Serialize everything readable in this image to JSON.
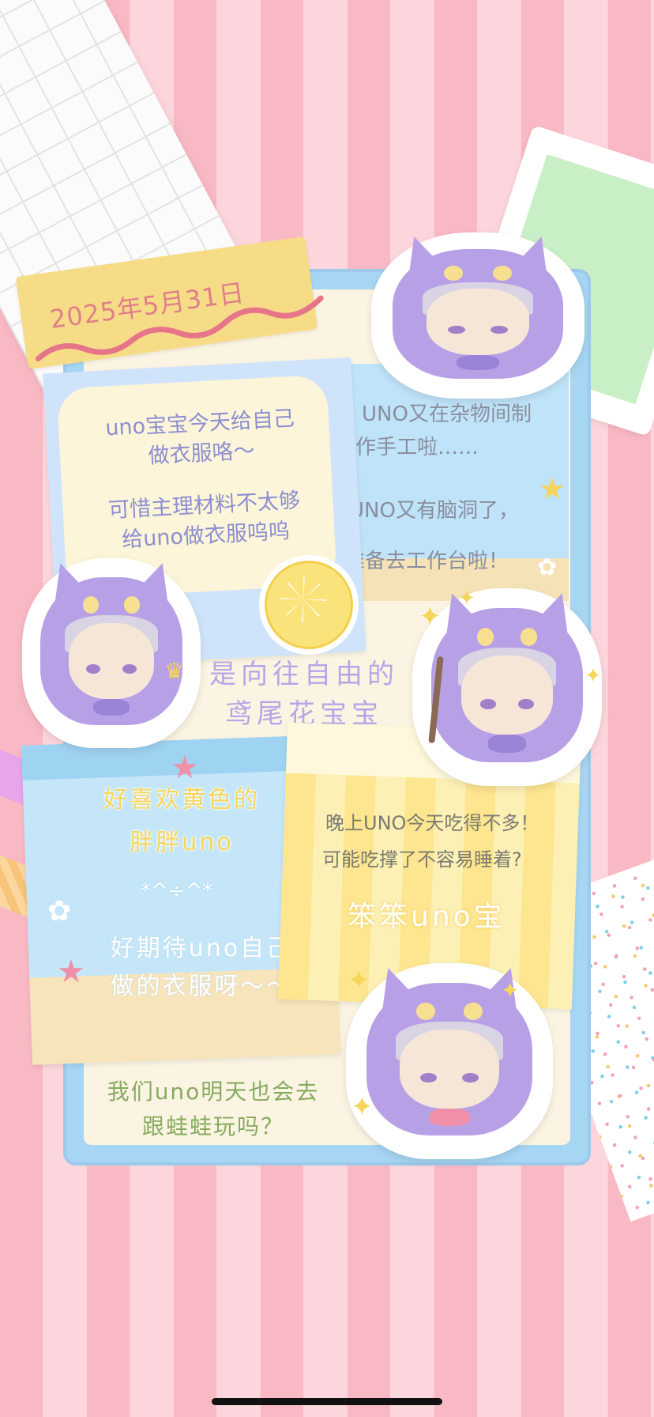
{
  "date": "2025年5月31日",
  "note_top_left": {
    "line1": "uno宝宝今天给自己",
    "line2": "做衣服咯～",
    "line3": "可惜主理材料不太够",
    "line4": "给uno做衣服呜呜"
  },
  "note_top_right": {
    "line1": "UNO又在杂物间制",
    "line2": "作手工啦……",
    "line3": "UNO又有脑洞了，",
    "line4": "准备去工作台啦！"
  },
  "heading_middle": {
    "line1": "是向往自由的",
    "line2": "鸢尾花宝宝"
  },
  "note_bottom_left": {
    "line1": "好喜欢黄色的",
    "line2": "胖胖uno",
    "emoticon": "*^÷^*",
    "line3": "好期待uno自己",
    "line4": "做的衣服呀～～"
  },
  "note_bottom_right": {
    "line1": "晚上UNO今天吃得不多！",
    "line2": "可能吃撑了不容易睡着?",
    "brand": "笨笨uno宝"
  },
  "bottom_panel": {
    "line1": "我们uno明天也会去",
    "line2": "跟蛙蛙玩吗？"
  },
  "icons": [
    "lemon-slice-icon",
    "star-icon",
    "starfish-icon",
    "shell-icon",
    "sparkle-icon",
    "magic-wand-icon",
    "crown-icon"
  ],
  "colors": {
    "stripe_pink": "#f9b9c4",
    "stripe_light": "#fcd6dc",
    "board_blue": "#a6d6f4",
    "character_purple": "#b8a0e6",
    "title_yellow": "#f6d65a",
    "heading_purple": "#b7a6e6",
    "text_green": "#86ab5f"
  }
}
